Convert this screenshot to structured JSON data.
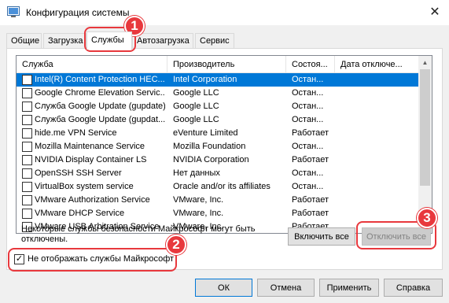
{
  "window": {
    "title": "Конфигурация системы",
    "close_glyph": "✕"
  },
  "tabs": [
    {
      "label": "Общие"
    },
    {
      "label": "Загрузка"
    },
    {
      "label": "Службы"
    },
    {
      "label": "Автозагрузка"
    },
    {
      "label": "Сервис"
    }
  ],
  "services": {
    "columns": [
      "Служба",
      "Производитель",
      "Состоя...",
      "Дата отключе..."
    ],
    "rows": [
      {
        "name": "Intel(R) Content Protection HEC...",
        "vendor": "Intel Corporation",
        "status": "Остан...",
        "date": "",
        "selected": true
      },
      {
        "name": "Google Chrome Elevation Servic...",
        "vendor": "Google LLC",
        "status": "Остан...",
        "date": ""
      },
      {
        "name": "Служба Google Update (gupdate)",
        "vendor": "Google LLC",
        "status": "Остан...",
        "date": ""
      },
      {
        "name": "Служба Google Update (gupdat...",
        "vendor": "Google LLC",
        "status": "Остан...",
        "date": ""
      },
      {
        "name": "hide.me VPN Service",
        "vendor": "eVenture Limited",
        "status": "Работает",
        "date": ""
      },
      {
        "name": "Mozilla Maintenance Service",
        "vendor": "Mozilla Foundation",
        "status": "Остан...",
        "date": ""
      },
      {
        "name": "NVIDIA Display Container LS",
        "vendor": "NVIDIA Corporation",
        "status": "Работает",
        "date": ""
      },
      {
        "name": "OpenSSH SSH Server",
        "vendor": "Нет данных",
        "status": "Остан...",
        "date": ""
      },
      {
        "name": "VirtualBox system service",
        "vendor": "Oracle and/or its affiliates",
        "status": "Остан...",
        "date": ""
      },
      {
        "name": "VMware Authorization Service",
        "vendor": "VMware, Inc.",
        "status": "Работает",
        "date": ""
      },
      {
        "name": "VMware DHCP Service",
        "vendor": "VMware, Inc.",
        "status": "Работает",
        "date": ""
      },
      {
        "name": "VMware USB Arbitration Service",
        "vendor": "VMware, Inc.",
        "status": "Работает",
        "date": ""
      }
    ]
  },
  "note": {
    "line1": "Некоторые службы безопасности Майкрософт могут быть",
    "line2": "отключены."
  },
  "buttons": {
    "enable_all": "Включить все",
    "disable_all": "Отключить все",
    "ok": "ОК",
    "cancel": "Отмена",
    "apply": "Применить",
    "help": "Справка"
  },
  "hide_ms": {
    "label": "Не отображать службы Майкрософт",
    "checked": true,
    "check_glyph": "✓"
  },
  "badges": {
    "one": "1",
    "two": "2",
    "three": "3"
  },
  "colors": {
    "accent": "#0078d7",
    "callout": "#e8383d"
  },
  "scroll": {
    "up_glyph": "▲",
    "down_glyph": "▼"
  }
}
